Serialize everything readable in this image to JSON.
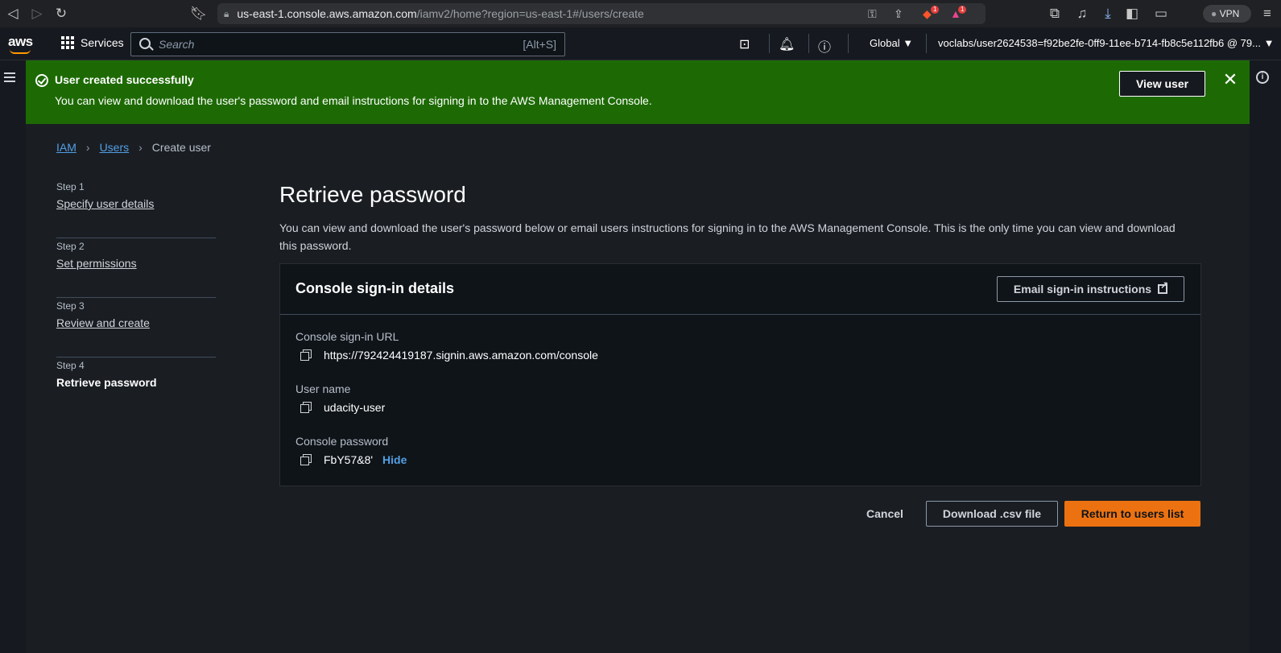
{
  "browser": {
    "url_host": "us-east-1.console.aws.amazon.com",
    "url_path": "/iamv2/home?region=us-east-1#/users/create",
    "brave_badge": "1",
    "alert_badge": "1",
    "vpn_label": "VPN"
  },
  "aws_nav": {
    "logo_text": "aws",
    "services_label": "Services",
    "search_placeholder": "Search",
    "search_shortcut": "[Alt+S]",
    "region_label": "Global ▼",
    "account_label": "voclabs/user2624538=f92be2fe-0ff9-11ee-b714-fb8c5e112fb6 @ 79... ▼"
  },
  "flash": {
    "title": "User created successfully",
    "message": "You can view and download the user's password and email instructions for signing in to the AWS Management Console.",
    "view_user_label": "View user",
    "close_symbol": "✕",
    "color": "#1d6a04"
  },
  "breadcrumb": {
    "items": [
      "IAM",
      "Users"
    ],
    "current": "Create user",
    "separator": "›"
  },
  "steps": [
    {
      "number": "Step 1",
      "label": "Specify user details"
    },
    {
      "number": "Step 2",
      "label": "Set permissions"
    },
    {
      "number": "Step 3",
      "label": "Review and create"
    },
    {
      "number": "Step 4",
      "label": "Retrieve password"
    }
  ],
  "page": {
    "title": "Retrieve password",
    "description": "You can view and download the user's password below or email users instructions for signing in to the AWS Management Console. This is the only time you can view and download this password."
  },
  "panel": {
    "title": "Console sign-in details",
    "email_button_label": "Email sign-in instructions",
    "fields": {
      "url_label": "Console sign-in URL",
      "url_value": "https://792424419187.signin.aws.amazon.com/console",
      "username_label": "User name",
      "username_value": "udacity-user",
      "password_label": "Console password",
      "password_value": "FbY57&8'",
      "hide_label": "Hide"
    }
  },
  "actions": {
    "cancel_label": "Cancel",
    "csv_label": "Download .csv file",
    "primary_label": "Return to users list",
    "primary_color": "#ec7211"
  }
}
